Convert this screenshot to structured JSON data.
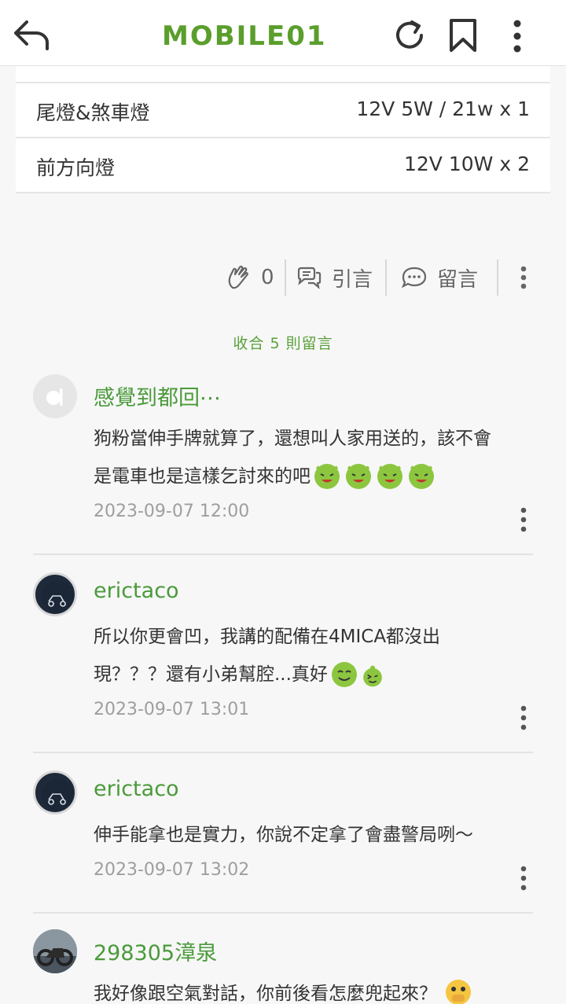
{
  "header": {
    "logo_text": "MOBILE01",
    "brand_color": "#5a9e2c"
  },
  "spec_rows": [
    {
      "label": "尾燈&煞車燈",
      "value": "12V 5W / 21w x 1"
    },
    {
      "label": "前方向燈",
      "value": "12V 10W x 2"
    }
  ],
  "actions": {
    "like_count": "0",
    "quote_label": "引言",
    "reply_label": "留言"
  },
  "collapse_label": "收合 5 則留言",
  "comments": [
    {
      "author": "感覺到都回⋯",
      "lines": [
        "狗粉當伸手牌就算了，還想叫人家用送的，該不會",
        "是電車也是這樣乞討來的吧"
      ],
      "time": "2023-09-07 12:00"
    },
    {
      "author": "erictaco",
      "lines": [
        "所以你更會凹，我講的配備在4MICA都沒出",
        "現？？？還有小弟幫腔...真好"
      ],
      "time": "2023-09-07 13:01"
    },
    {
      "author": "erictaco",
      "lines": [
        "伸手能拿也是實力，你說不定拿了會盡警局咧～"
      ],
      "time": "2023-09-07 13:02"
    },
    {
      "author": "298305漳泉",
      "lines": [
        "我好像跟空氣對話，你前後看怎麼兜起來？"
      ],
      "time": ""
    }
  ]
}
